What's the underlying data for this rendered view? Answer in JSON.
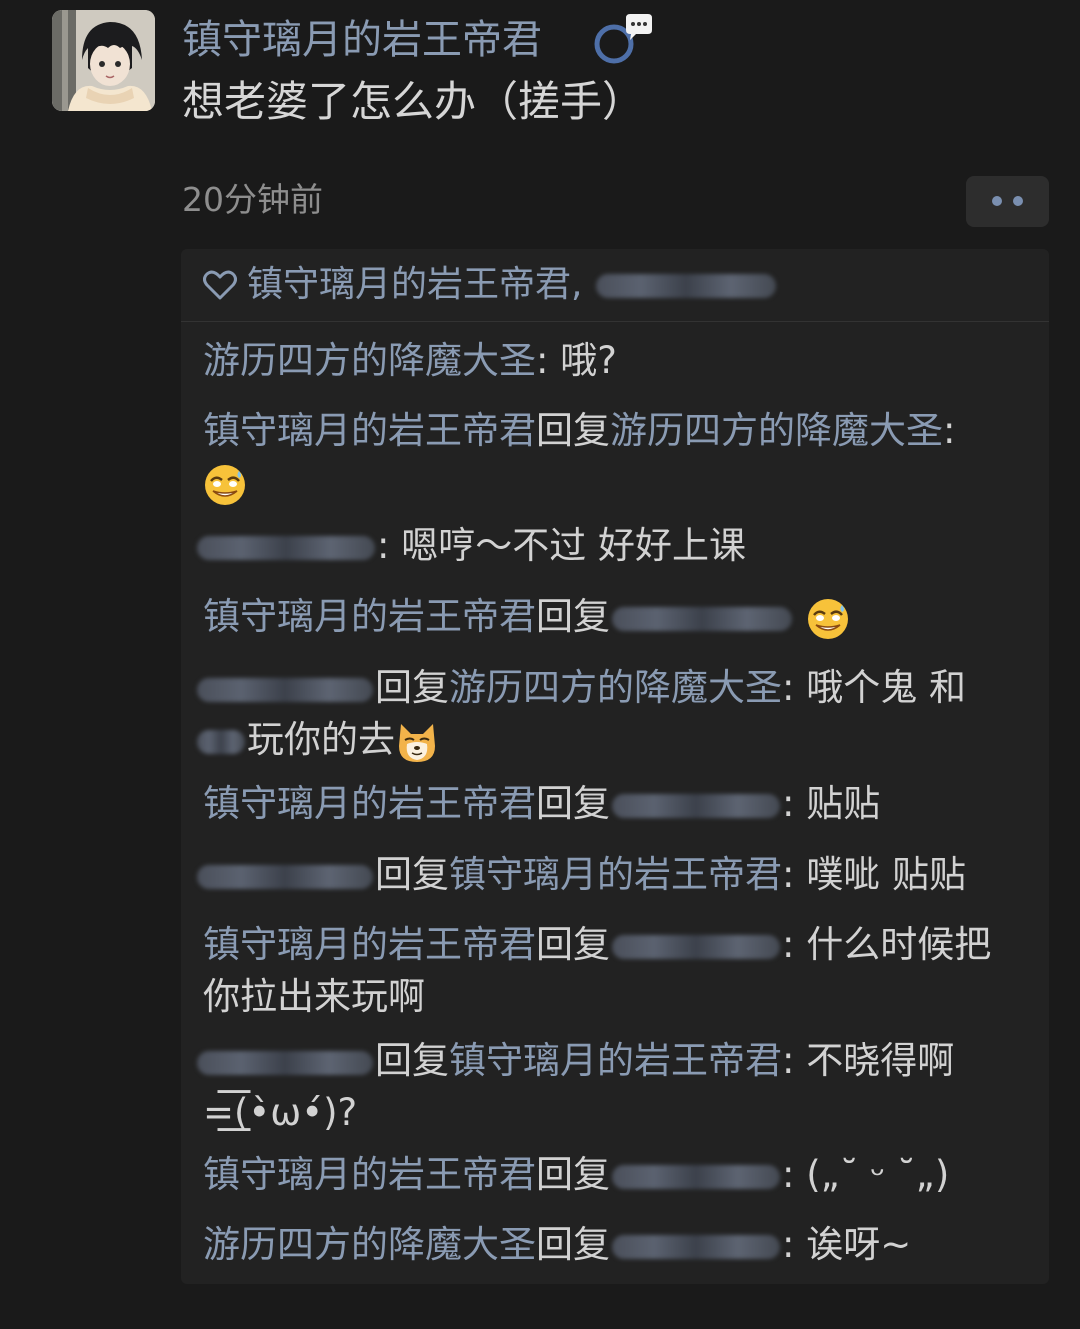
{
  "post": {
    "username": "镇守璃月的岩王帝君",
    "text": "想老婆了怎么办（搓手）",
    "timestamp": "20分钟前"
  },
  "likes": {
    "text": "镇守璃月的岩王帝君,"
  },
  "comments": [
    {
      "author": "游历四方的降魔大圣",
      "separator": ":",
      "text": " 哦?"
    },
    {
      "author": "镇守璃月的岩王帝君",
      "reply_word": "回复",
      "reply_to": "游历四方的降魔大圣",
      "separator": ":",
      "emoji": "grinning-sweat-emoji"
    },
    {
      "separator": ":",
      "text": " 嗯哼～不过 好好上课"
    },
    {
      "author": "镇守璃月的岩王帝君",
      "reply_word": "回复",
      "emoji": "grinning-sweat-emoji"
    },
    {
      "reply_word": "回复",
      "reply_to": "游历四方的降魔大圣",
      "separator": ":",
      "text": " 哦个鬼 和",
      "text2": "玩你的去",
      "emoji": "doge-emoji"
    },
    {
      "author": "镇守璃月的岩王帝君",
      "reply_word": "回复",
      "separator": ":",
      "text": " 贴贴"
    },
    {
      "reply_word": "回复",
      "reply_to": "镇守璃月的岩王帝君",
      "separator": ":",
      "text": " 噗呲 贴贴"
    },
    {
      "author": "镇守璃月的岩王帝君",
      "reply_word": "回复",
      "separator": ":",
      "text": " 什么时候把",
      "text2": "你拉出来玩啊"
    },
    {
      "reply_word": "回复",
      "reply_to": "镇守璃月的岩王帝君",
      "separator": ":",
      "text": " 不晓得啊",
      "text2": "=͟͟͞͞(•̀ω•́)?"
    },
    {
      "author": "镇守璃月的岩王帝君",
      "reply_word": "回复",
      "separator": ":",
      "text": " („˘ ᵕ ˘„)"
    },
    {
      "author": "游历四方的降魔大圣",
      "reply_word": "回复",
      "separator": ":",
      "text": " 诶呀~"
    }
  ],
  "icons": {
    "badge": "speech-bubble-badge-icon",
    "heart": "heart-outline-icon",
    "more": "more-dots-icon"
  },
  "colors": {
    "background": "#1a1a1a",
    "panel": "#222222",
    "name": "#8a9bb3",
    "text": "#d2d2d2",
    "muted": "#8e8e8e"
  }
}
